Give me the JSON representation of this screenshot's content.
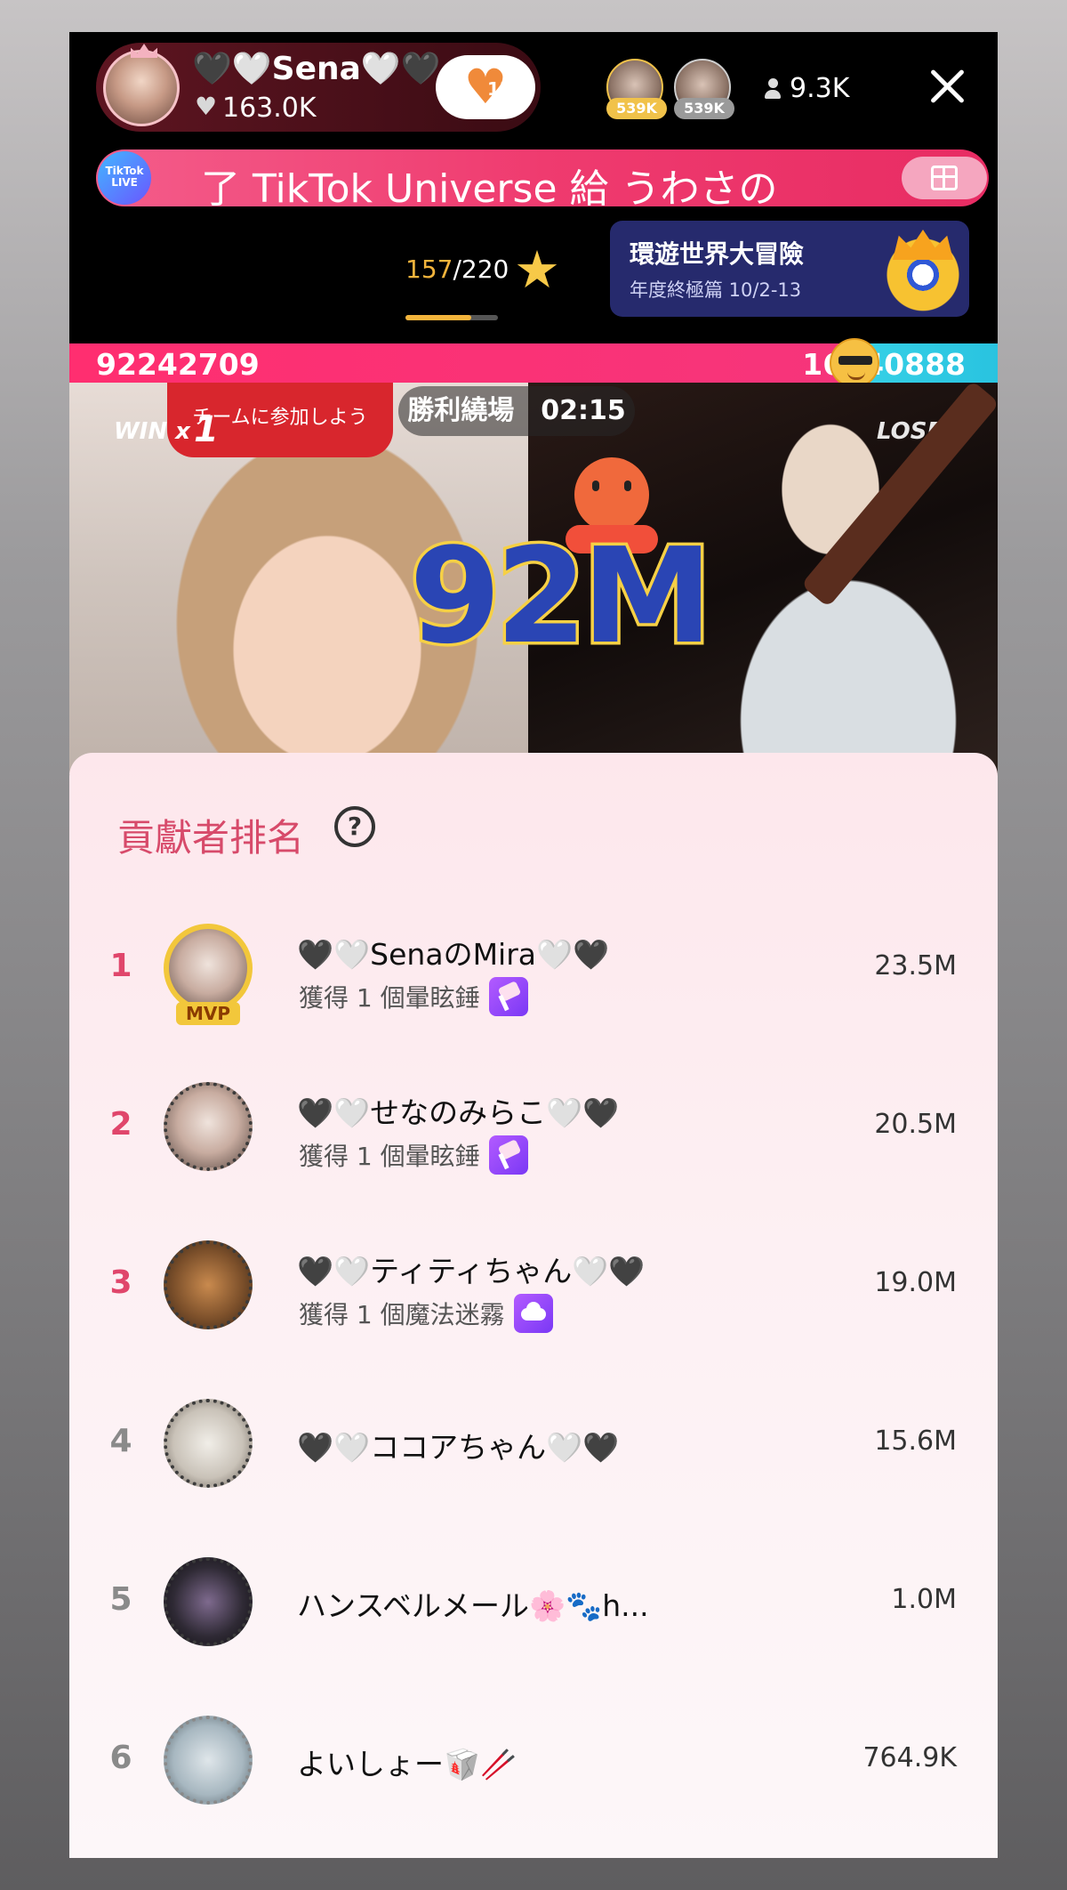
{
  "header": {
    "host_name": "🖤🤍Sena🤍🖤",
    "host_likes": "163.0K",
    "follow_count": "12",
    "viewer_badges": [
      "539K",
      "539K"
    ],
    "viewer_count": "9.3K"
  },
  "banner": {
    "badge_text": "TikTok LIVE",
    "text": "了 TikTok Universe 給 うわさの"
  },
  "progress": {
    "current": "157",
    "total": "/220",
    "fraction": 0.71
  },
  "event": {
    "title": "環遊世界大冒險",
    "subtitle": "年度終極篇 10/2-13"
  },
  "battle": {
    "left_score": "92242709",
    "right_score": "16740888",
    "left_share": 0.846,
    "win_label": "WIN x",
    "win_count": "1",
    "timer": "勝利繞場　02:15",
    "lose_label": "LOSE",
    "big_score": "92M",
    "sign_text": "チームに参加しよう"
  },
  "ranking": {
    "title": "貢獻者排名",
    "help": "?",
    "mvp_label": "MVP",
    "rows": [
      {
        "rank": "1",
        "name": "🖤🤍SenaのMira🤍🖤",
        "sub": "獲得 1 個暈眩錘",
        "item": "hammer-icon",
        "score": "23.5M"
      },
      {
        "rank": "2",
        "name": "🖤🤍せなのみらこ🤍🖤",
        "sub": "獲得 1 個暈眩錘",
        "item": "hammer-icon",
        "score": "20.5M"
      },
      {
        "rank": "3",
        "name": "🖤🤍ティティちゃん🤍🖤",
        "sub": "獲得 1 個魔法迷霧",
        "item": "cloud-icon",
        "score": "19.0M"
      },
      {
        "rank": "4",
        "name": "🖤🤍ココアちゃん🤍🖤",
        "sub": "",
        "item": "",
        "score": "15.6M"
      },
      {
        "rank": "5",
        "name": "ハンスベルメール🌸🐾h...",
        "sub": "",
        "item": "",
        "score": "1.0M"
      },
      {
        "rank": "6",
        "name": "よいしょー🥡🥢",
        "sub": "",
        "item": "",
        "score": "764.9K"
      }
    ]
  }
}
